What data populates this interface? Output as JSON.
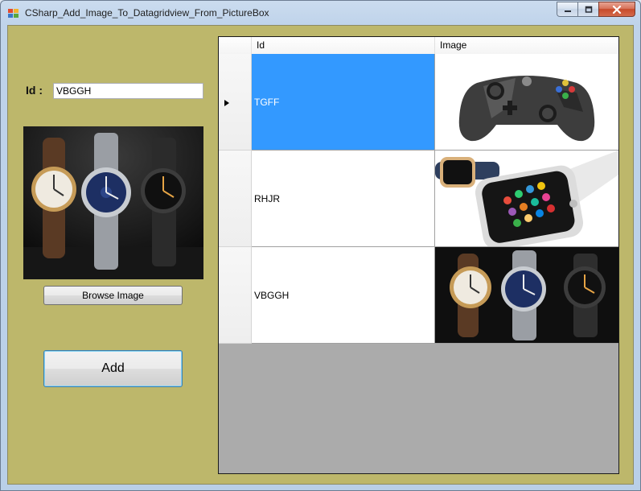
{
  "window": {
    "title": "CSharp_Add_Image_To_Datagridview_From_PictureBox",
    "controls": {
      "minimize": "minimize-icon",
      "maximize": "maximize-icon",
      "close": "close-icon"
    }
  },
  "form": {
    "background_color": "#BDB76B",
    "id_label": "Id :",
    "id_value": "VBGGH",
    "picture": "smartwatches-image",
    "browse_button": "Browse Image",
    "add_button": "Add"
  },
  "grid": {
    "columns": [
      "Id",
      "Image"
    ],
    "selection_color": "#3399FF",
    "rows": [
      {
        "id": "TGFF",
        "image": "game-controller-image",
        "selected": true
      },
      {
        "id": "RHJR",
        "image": "smartwatch-apps-image",
        "selected": false
      },
      {
        "id": "VBGGH",
        "image": "smartwatches-image",
        "selected": false
      }
    ]
  }
}
